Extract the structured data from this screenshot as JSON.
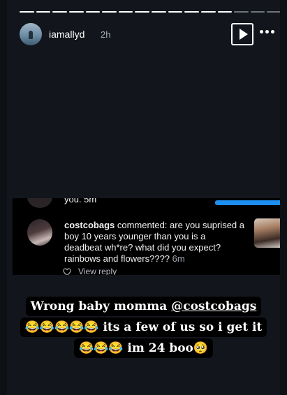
{
  "story": {
    "username": "iamallyd",
    "time": "2h",
    "progress": {
      "total_segments": 16,
      "viewed_segments": 13
    },
    "icons": {
      "play": "play-icon",
      "more": "more-options-icon"
    }
  },
  "screenshot": {
    "previous_comment_fragment": "you. 5m",
    "comment": {
      "username": "costcobags",
      "action": "commented:",
      "text": "are you suprised a boy 10 years younger than you is a deadbeat wh*re? what did you expect? rainbows and flowers????",
      "time": "6m"
    },
    "view_reply": "View reply"
  },
  "caption": {
    "line1_text": "Wrong baby momma ",
    "line1_mention": "@costcobags",
    "line2": "😂😂😂😂😂 its a few of us so i get it",
    "line3": "😂😂😂 im 24 boo🥺"
  }
}
